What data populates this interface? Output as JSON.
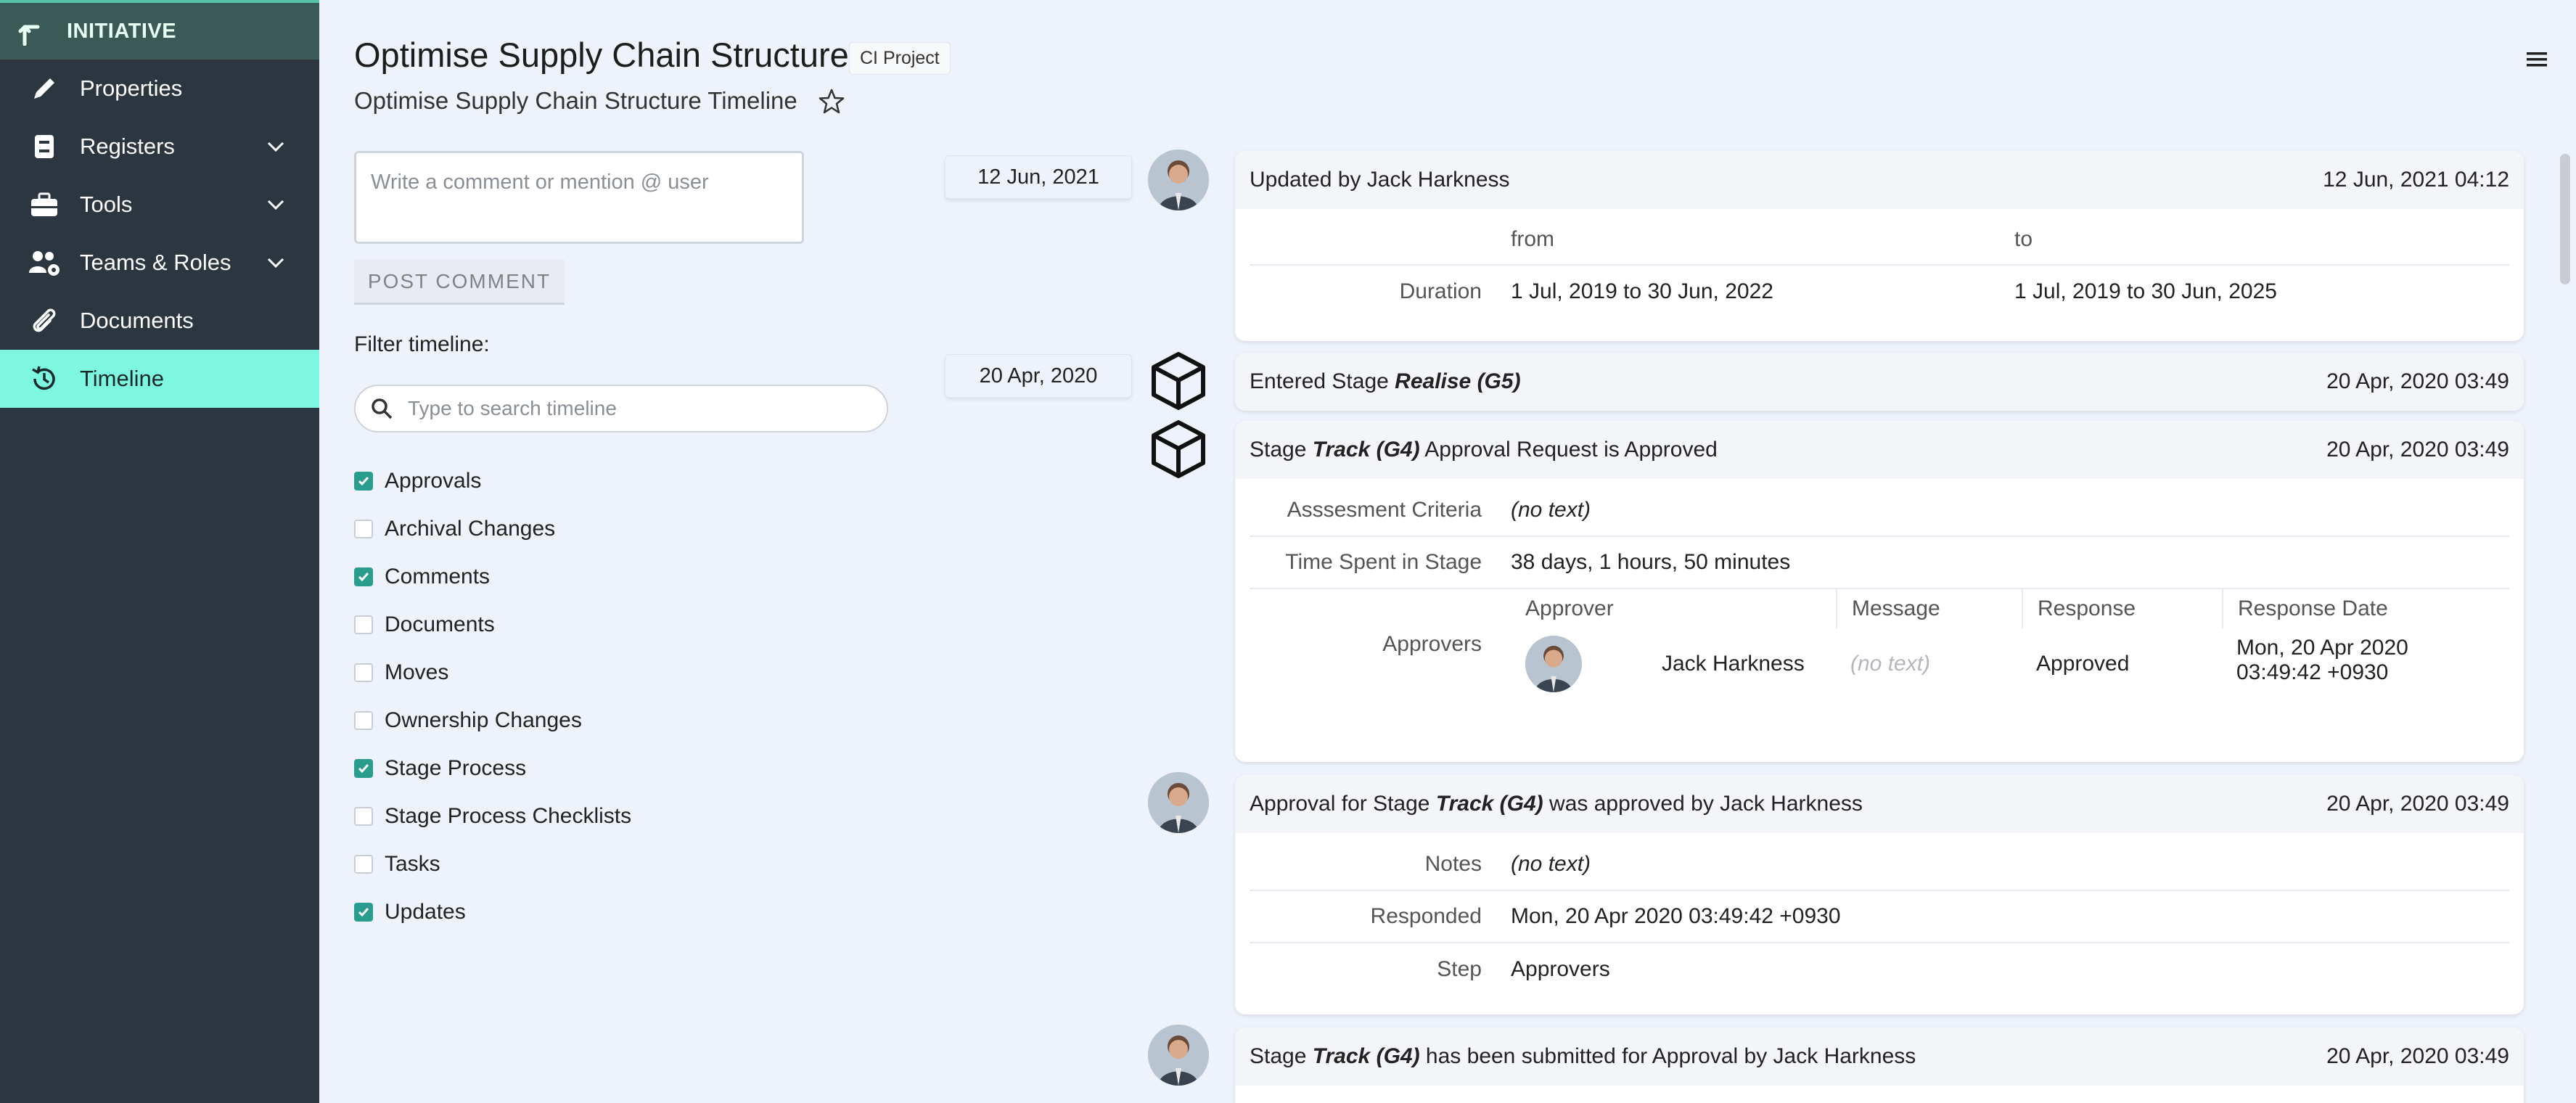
{
  "sidebar": {
    "header": "INITIATIVE",
    "items": [
      {
        "label": "Properties",
        "icon": "pencil-icon"
      },
      {
        "label": "Registers",
        "icon": "register-icon",
        "expand": true
      },
      {
        "label": "Tools",
        "icon": "toolbox-icon",
        "expand": true
      },
      {
        "label": "Teams & Roles",
        "icon": "teams-icon",
        "expand": true
      },
      {
        "label": "Documents",
        "icon": "paperclip-icon"
      },
      {
        "label": "Timeline",
        "icon": "history-icon",
        "active": true
      }
    ],
    "colors": {
      "bg": "#2c3640",
      "active": "#7ef7e1",
      "header": "#3b5a55"
    }
  },
  "header": {
    "title": "Optimise Supply Chain Structure",
    "badge": "CI Project",
    "subtitle": "Optimise Supply Chain Structure Timeline"
  },
  "comment": {
    "placeholder": "Write a comment or mention @ user",
    "post_label": "POST COMMENT"
  },
  "filter": {
    "label": "Filter timeline:",
    "search_placeholder": "Type to search timeline",
    "options": [
      {
        "label": "Approvals",
        "checked": true
      },
      {
        "label": "Archival Changes",
        "checked": false
      },
      {
        "label": "Comments",
        "checked": true
      },
      {
        "label": "Documents",
        "checked": false
      },
      {
        "label": "Moves",
        "checked": false
      },
      {
        "label": "Ownership Changes",
        "checked": false
      },
      {
        "label": "Stage Process",
        "checked": true
      },
      {
        "label": "Stage Process Checklists",
        "checked": false
      },
      {
        "label": "Tasks",
        "checked": false
      },
      {
        "label": "Updates",
        "checked": true
      }
    ]
  },
  "timeline": {
    "dates": [
      "12 Jun, 2021",
      "20 Apr, 2020"
    ],
    "update_card": {
      "title": "Updated by Jack Harkness",
      "time": "12 Jun, 2021 04:12",
      "from_label": "from",
      "to_label": "to",
      "field": "Duration",
      "from_value": "1 Jul, 2019 to 30 Jun, 2022",
      "to_value": "1 Jul, 2019 to 30 Jun, 2025"
    },
    "entered_card": {
      "prefix": "Entered Stage ",
      "stage": "Realise (G5)",
      "time": "20 Apr, 2020 03:49"
    },
    "approval_request_card": {
      "prefix": "Stage ",
      "stage": "Track (G4)",
      "suffix": " Approval Request is Approved",
      "time": "20 Apr, 2020 03:49",
      "criteria_label": "Asssesment Criteria",
      "criteria_value": "(no text)",
      "time_spent_label": "Time Spent in Stage",
      "time_spent_value": "38 days, 1 hours, 50 minutes",
      "approvers_label": "Approvers",
      "columns": [
        "Approver",
        "Message",
        "Response",
        "Response Date"
      ],
      "approver_name": "Jack Harkness",
      "message": "(no text)",
      "response": "Approved",
      "response_date_line1": "Mon, 20 Apr 2020",
      "response_date_line2": "03:49:42 +0930"
    },
    "approval_card": {
      "prefix": "Approval for Stage ",
      "stage": "Track (G4)",
      "suffix": " was approved by Jack Harkness",
      "time": "20 Apr, 2020 03:49",
      "notes_label": "Notes",
      "notes_value": "(no text)",
      "responded_label": "Responded",
      "responded_value": "Mon, 20 Apr 2020 03:49:42 +0930",
      "step_label": "Step",
      "step_value": "Approvers"
    },
    "submitted_card": {
      "prefix": "Stage ",
      "stage": "Track (G4)",
      "suffix": " has been submitted for Approval by Jack Harkness",
      "time": "20 Apr, 2020 03:49"
    }
  }
}
